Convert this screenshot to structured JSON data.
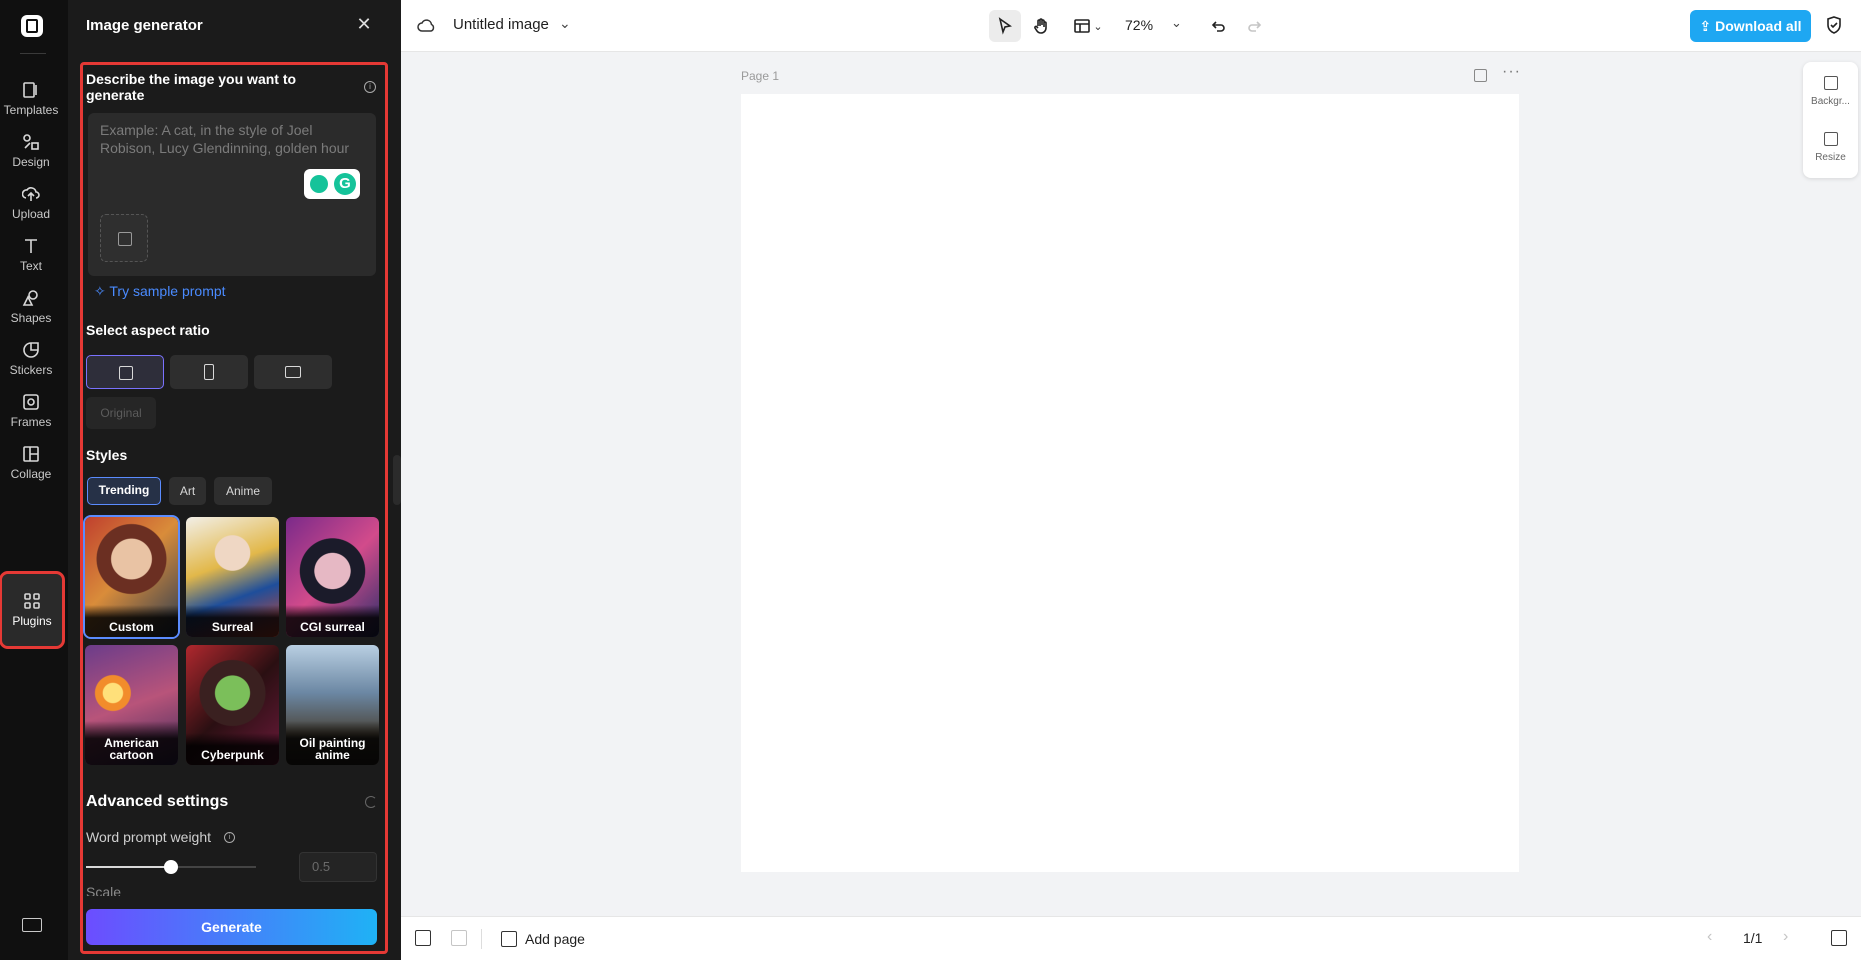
{
  "rail": {
    "items": [
      {
        "label": "Templates",
        "icon": "templates-icon"
      },
      {
        "label": "Design",
        "icon": "design-icon"
      },
      {
        "label": "Upload",
        "icon": "upload-icon"
      },
      {
        "label": "Text",
        "icon": "text-icon"
      },
      {
        "label": "Shapes",
        "icon": "shapes-icon"
      },
      {
        "label": "Stickers",
        "icon": "stickers-icon"
      },
      {
        "label": "Frames",
        "icon": "frames-icon"
      },
      {
        "label": "Collage",
        "icon": "collage-icon"
      },
      {
        "label": "Plugins",
        "icon": "plugins-icon"
      }
    ],
    "active": "Plugins"
  },
  "panel": {
    "title": "Image generator",
    "describe_label": "Describe the image you want to generate",
    "prompt_placeholder": "Example: A cat, in the style of Joel Robison, Lucy Glendinning, golden hour",
    "sample_prompt": "Try sample prompt",
    "aspect_label": "Select aspect ratio",
    "aspect_options": [
      "square",
      "portrait",
      "landscape"
    ],
    "aspect_selected": "square",
    "original_label": "Original",
    "styles_label": "Styles",
    "style_tabs": [
      "Trending",
      "Art",
      "Anime"
    ],
    "style_tab_selected": "Trending",
    "style_cards": [
      {
        "label": "Custom",
        "selected": true
      },
      {
        "label": "Surreal",
        "selected": false
      },
      {
        "label": "CGI surreal",
        "selected": false
      },
      {
        "label": "American cartoon",
        "selected": false
      },
      {
        "label": "Cyberpunk",
        "selected": false
      },
      {
        "label": "Oil painting anime",
        "selected": false
      }
    ],
    "advanced_label": "Advanced settings",
    "word_prompt_weight_label": "Word prompt weight",
    "word_prompt_weight_value": "0.5",
    "word_prompt_weight_fraction": 0.5,
    "scale_label": "Scale",
    "generate_label": "Generate"
  },
  "topbar": {
    "doc_title": "Untitled image",
    "zoom": "72%",
    "download_label": "Download all"
  },
  "canvas": {
    "page_label": "Page 1"
  },
  "right_panel": {
    "background_label": "Backgr...",
    "resize_label": "Resize"
  },
  "bottombar": {
    "add_page_label": "Add page",
    "pager": "1/1"
  },
  "colors": {
    "accent_blue": "#1ea7f2",
    "highlight_red": "#e53935",
    "generate_gradient_start": "#6c4dff",
    "generate_gradient_end": "#1fb2f5"
  }
}
